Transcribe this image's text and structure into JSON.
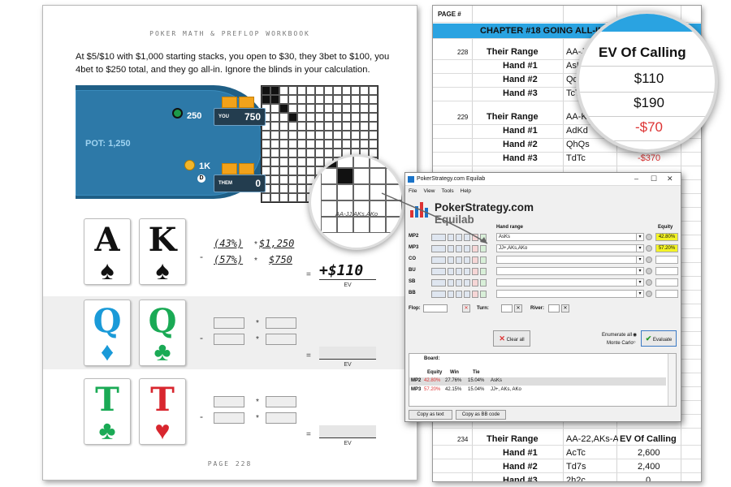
{
  "book": {
    "header": "POKER MATH & PREFLOP WORKBOOK",
    "paragraph": "At $5/$10 with $1,000 starting stacks, you open to $30, they 3bet to $100, you 4bet to $250 total, and they go all-in. Ignore the blinds in your calculation.",
    "pot_label": "POT: 1,250",
    "villain_chips": "250",
    "hero_chips": "1K",
    "seat_you_label": "YOU",
    "seat_you_stack": "750",
    "seat_them_label": "THEM",
    "seat_them_stack": "0",
    "dealer": "D",
    "matrix_caption": "AA-JJ,AKs,AKo",
    "rows": [
      {
        "cards": [
          {
            "rank": "A",
            "suit": "♠",
            "color": "#111"
          },
          {
            "rank": "K",
            "suit": "♠",
            "color": "#111"
          }
        ],
        "eq1": "(43%)",
        "val1": "$1,250",
        "eq2": "(57%)",
        "val2": "$750",
        "answer": "+$110",
        "ev": "EV"
      },
      {
        "cards": [
          {
            "rank": "Q",
            "suit": "♦",
            "color": "#1a9ad8"
          },
          {
            "rank": "Q",
            "suit": "♣",
            "color": "#1aaa55"
          }
        ],
        "ev": "EV"
      },
      {
        "cards": [
          {
            "rank": "T",
            "suit": "♣",
            "color": "#1aaa55"
          },
          {
            "rank": "T",
            "suit": "♥",
            "color": "#d8262e"
          }
        ],
        "ev": "EV"
      }
    ],
    "page": "PAGE 228"
  },
  "sheet": {
    "page_label": "PAGE #",
    "chapter": "CHAPTER #18 GOING ALL-IN P",
    "blocks": [
      {
        "page": "228",
        "range_label": "Their Range",
        "range": "AA-JJ,AKs,A",
        "hands": [
          [
            "Hand #1",
            "AsKs"
          ],
          [
            "Hand #2",
            "QdQc"
          ],
          [
            "Hand #3",
            "TcTh"
          ]
        ]
      },
      {
        "page": "229",
        "range_label": "Their Range",
        "range": "AA-KK",
        "hands": [
          [
            "Hand #1",
            "AdKd"
          ],
          [
            "Hand #2",
            "QhQs"
          ],
          [
            "Hand #3",
            "TdTc"
          ]
        ],
        "ev3": "-$370"
      },
      {
        "page": "234",
        "range_label": "Their Range",
        "range": "AA-22,AKs-A2s,KQ",
        "ev_header": "EV Of Calling",
        "hands": [
          [
            "Hand #1",
            "AcTc",
            "2,600"
          ],
          [
            "Hand #2",
            "Td7s",
            "2,400"
          ],
          [
            "Hand #3",
            "2h2c",
            "0"
          ]
        ]
      }
    ],
    "magnifier": {
      "header": "EV Of Calling",
      "values": [
        "$110",
        "$190",
        "-$70"
      ]
    }
  },
  "equilab": {
    "title": "PokerStrategy.com Equilab",
    "menu": [
      "File",
      "View",
      "Tools",
      "Help"
    ],
    "logo_main": "PokerStrategy.com",
    "logo_sub": "Equilab",
    "hand_range_header": "Hand range",
    "equity_header": "Equity",
    "players": [
      {
        "name": "MP2",
        "range": "AsKs",
        "equity": "42.80%"
      },
      {
        "name": "MP3",
        "range": "JJ+,AKs,AKo",
        "equity": "57.20%"
      },
      {
        "name": "CO",
        "range": "",
        "equity": ""
      },
      {
        "name": "BU",
        "range": "",
        "equity": ""
      },
      {
        "name": "SB",
        "range": "",
        "equity": ""
      },
      {
        "name": "BB",
        "range": "",
        "equity": ""
      }
    ],
    "flop_label": "Flop:",
    "turn_label": "Turn:",
    "river_label": "River:",
    "clear_label": "Clear all",
    "enum_label": "Enumerate all",
    "mc_label": "Monte Carlo",
    "evaluate_label": "Evaluate",
    "board_label": "Board:",
    "res_headers": [
      "Equity",
      "Win",
      "Tie"
    ],
    "results": [
      {
        "name": "MP2",
        "equity": "42.80%",
        "win": "27.76%",
        "tie": "15.04%",
        "hands": "AsKs"
      },
      {
        "name": "MP3",
        "equity": "57.20%",
        "win": "42.15%",
        "tie": "15.04%",
        "hands": "JJ+, AKs, AKo"
      }
    ],
    "copy_text": "Copy as text",
    "copy_bb": "Copy as BB code"
  }
}
